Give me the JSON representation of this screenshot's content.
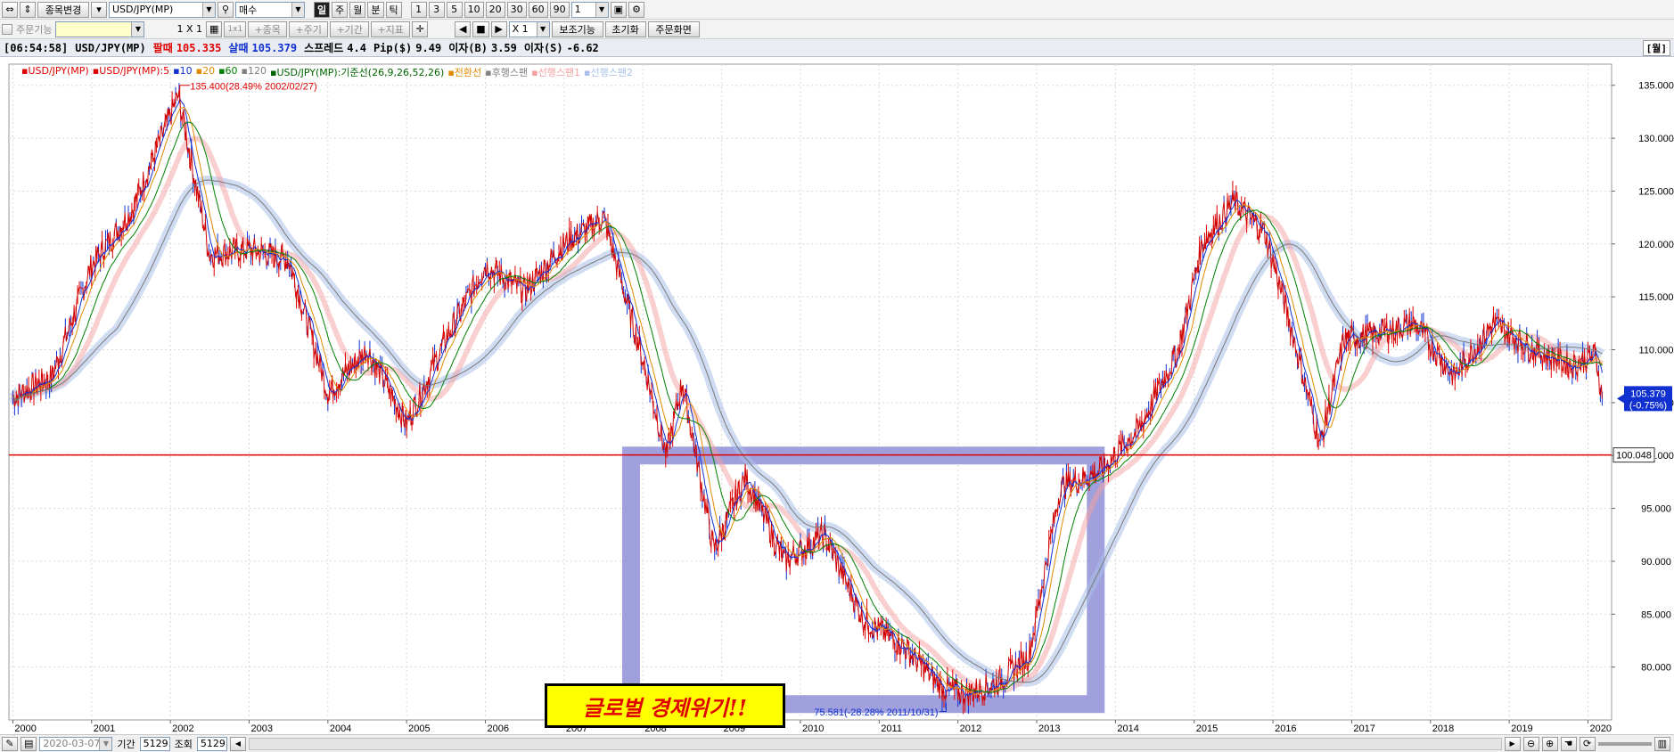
{
  "toolbar1": {
    "stock_change_label": "종목변경",
    "symbol_value": "USD/JPY(MP)",
    "side_value": "매수",
    "period_buttons": [
      "일",
      "주",
      "월",
      "분",
      "틱"
    ],
    "interval_buttons": [
      "1",
      "3",
      "5",
      "10",
      "20",
      "30",
      "60",
      "90"
    ],
    "interval_value": "1"
  },
  "toolbar2": {
    "order_func_label": "주문기능",
    "layout_label": "1 X 1",
    "layout_small": "1x1",
    "btn_symbol": "+종목",
    "btn_cycle": "+주기",
    "btn_period": "+기간",
    "btn_indicator": "+지표",
    "multiplier_value": "X 1",
    "btn_aux": "보조기능",
    "btn_reset": "초기화",
    "btn_order_screen": "주문화면"
  },
  "infobar": {
    "time": "[06:54:58]",
    "symbol": "USD/JPY(MP)",
    "sell_label": "팔때",
    "sell_value": "105.335",
    "buy_label": "살때",
    "buy_value": "105.379",
    "spread_label": "스프레드",
    "spread_value": "4.4",
    "pip_label": "Pip($)",
    "pip_value": "9.49",
    "interest_buy_label": "이자(B)",
    "interest_buy_value": "3.59",
    "interest_sell_label": "이자(S)",
    "interest_sell_value": "-6.62",
    "unit_badge": "[월]"
  },
  "legend": [
    {
      "text": "USD/JPY(MP)",
      "color": "#e00000"
    },
    {
      "text": "USD/JPY(MP):5",
      "color": "#e00000"
    },
    {
      "text": "10",
      "color": "#1030d0"
    },
    {
      "text": "20",
      "color": "#e08a00"
    },
    {
      "text": "60",
      "color": "#008000"
    },
    {
      "text": "120",
      "color": "#808080"
    },
    {
      "text": "USD/JPY(MP):기준선(26,9,26,52,26)",
      "color": "#006400"
    },
    {
      "text": "전환선",
      "color": "#e08a00"
    },
    {
      "text": "후행스팬",
      "color": "#808080"
    },
    {
      "text": "선행스팬1",
      "color": "#f4a0a0"
    },
    {
      "text": "선행스팬2",
      "color": "#a8c0e8"
    }
  ],
  "chart_data": {
    "type": "line",
    "title": "",
    "xlabel": "",
    "ylabel": "",
    "x_years": [
      "2000",
      "2001",
      "2002",
      "2003",
      "2004",
      "2005",
      "2006",
      "2007",
      "2008",
      "2009",
      "2010",
      "2011",
      "2012",
      "2013",
      "2014",
      "2015",
      "2016",
      "2017",
      "2018",
      "2019",
      "2020"
    ],
    "y_ticks": [
      "80.000",
      "85.000",
      "90.000",
      "95.000",
      "100.000",
      "105.000",
      "110.000",
      "115.000",
      "120.000",
      "125.000",
      "130.000",
      "135.000"
    ],
    "ylim": [
      75,
      137
    ],
    "series": [
      {
        "name": "USD/JPY(MP)",
        "x": [
          2000.0,
          2000.5,
          2001.0,
          2001.5,
          2002.1,
          2002.5,
          2003.0,
          2003.5,
          2004.0,
          2004.5,
          2005.0,
          2005.5,
          2006.0,
          2006.5,
          2007.0,
          2007.5,
          2008.0,
          2008.3,
          2008.5,
          2008.9,
          2009.3,
          2009.8,
          2010.3,
          2010.8,
          2011.3,
          2011.8,
          2012.1,
          2012.5,
          2012.9,
          2013.3,
          2013.8,
          2014.3,
          2014.8,
          2015.1,
          2015.5,
          2015.9,
          2016.2,
          2016.6,
          2016.9,
          2017.3,
          2017.8,
          2018.3,
          2018.8,
          2019.3,
          2019.8,
          2020.1,
          2020.18
        ],
        "values": [
          105.5,
          107.5,
          118.0,
          123.0,
          134.0,
          119.0,
          119.5,
          118.5,
          106.0,
          110.0,
          103.0,
          111.0,
          118.0,
          115.5,
          120.0,
          122.5,
          109.0,
          100.0,
          107.0,
          91.0,
          98.0,
          90.0,
          92.5,
          84.5,
          82.0,
          78.0,
          77.5,
          78.5,
          81.0,
          97.0,
          98.5,
          102.5,
          110.0,
          120.0,
          124.0,
          121.0,
          113.0,
          101.0,
          111.0,
          111.5,
          112.5,
          107.5,
          112.5,
          110.0,
          108.5,
          109.5,
          105.379
        ]
      }
    ],
    "horizontal_line": {
      "value": "100.048",
      "color": "#e00000"
    },
    "current_price": {
      "value": "105.379",
      "change": "(-0.75%)"
    },
    "annotation_high": "135.400(28.49% 2002/02/27)",
    "annotation_low": "75.581(-28.28% 2011/10/31)",
    "highlight_region": {
      "x_start": 2007.85,
      "x_end": 2013.75,
      "y_top": 100.0,
      "y_bottom": 76.5
    },
    "callout_text": "글로벌 경제위기!!",
    "grid": true,
    "legend_position": "top-left"
  },
  "bottombar": {
    "date_value": "2020-03-07",
    "period_label": "기간",
    "period_value": "5129",
    "query_label": "조회",
    "query_value": "5129"
  }
}
